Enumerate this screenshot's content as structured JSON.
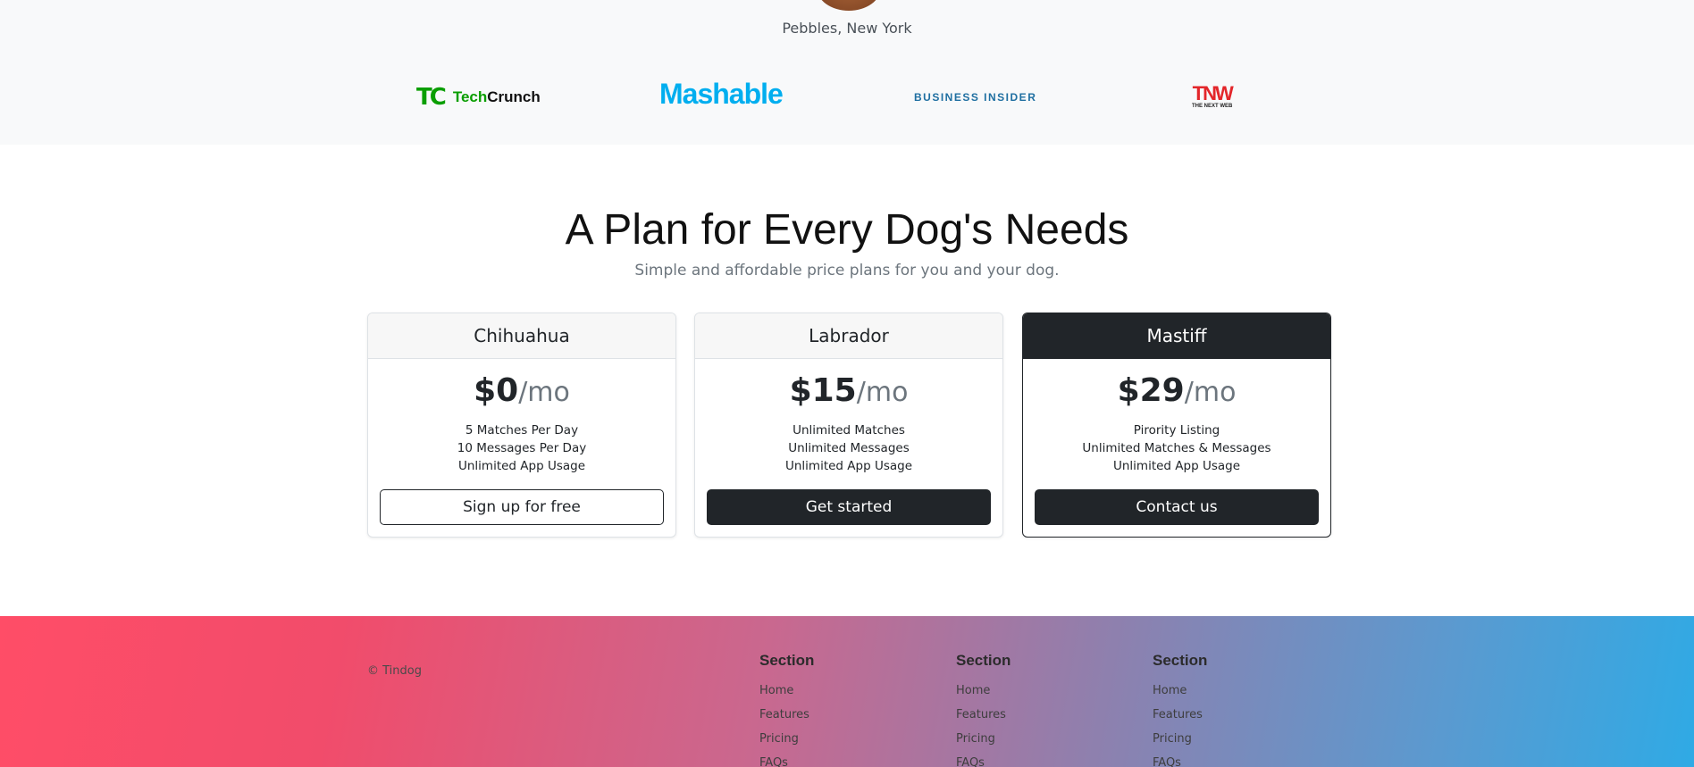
{
  "testimonial": {
    "author": "Pebbles, New York"
  },
  "press_logos": [
    {
      "name": "TechCrunch",
      "mark": "TC",
      "text_a": "Tech",
      "text_b": "Crunch",
      "color": "#0a9e01"
    },
    {
      "name": "Mashable",
      "text": "Mashable",
      "color": "#00aeef"
    },
    {
      "name": "Business Insider",
      "text": "BUSINESS INSIDER",
      "color": "#1f6fa1"
    },
    {
      "name": "The Next Web",
      "big": "TNW",
      "small": "THE NEXT WEB",
      "color": "#e3262a"
    }
  ],
  "pricing": {
    "title": "A Plan for Every Dog's Needs",
    "subtitle": "Simple and affordable price plans for you and your dog.",
    "plans": [
      {
        "name": "Chihuahua",
        "price": "$0",
        "per": "/mo",
        "features": [
          "5 Matches Per Day",
          "10 Messages Per Day",
          "Unlimited App Usage"
        ],
        "button": "Sign up for free"
      },
      {
        "name": "Labrador",
        "price": "$15",
        "per": "/mo",
        "features": [
          "Unlimited Matches",
          "Unlimited Messages",
          "Unlimited App Usage"
        ],
        "button": "Get started"
      },
      {
        "name": "Mastiff",
        "price": "$29",
        "per": "/mo",
        "features": [
          "Pirority Listing",
          "Unlimited Matches & Messages",
          "Unlimited App Usage"
        ],
        "button": "Contact us"
      }
    ]
  },
  "footer": {
    "copyright": "© Tindog",
    "columns": [
      {
        "title": "Section",
        "links": [
          "Home",
          "Features",
          "Pricing",
          "FAQs"
        ]
      },
      {
        "title": "Section",
        "links": [
          "Home",
          "Features",
          "Pricing",
          "FAQs"
        ]
      },
      {
        "title": "Section",
        "links": [
          "Home",
          "Features",
          "Pricing",
          "FAQs"
        ]
      }
    ]
  },
  "colors": {
    "dark": "#212529",
    "muted": "#6c757d",
    "footer_start": "#ff4d67",
    "footer_end": "#2faae5"
  }
}
